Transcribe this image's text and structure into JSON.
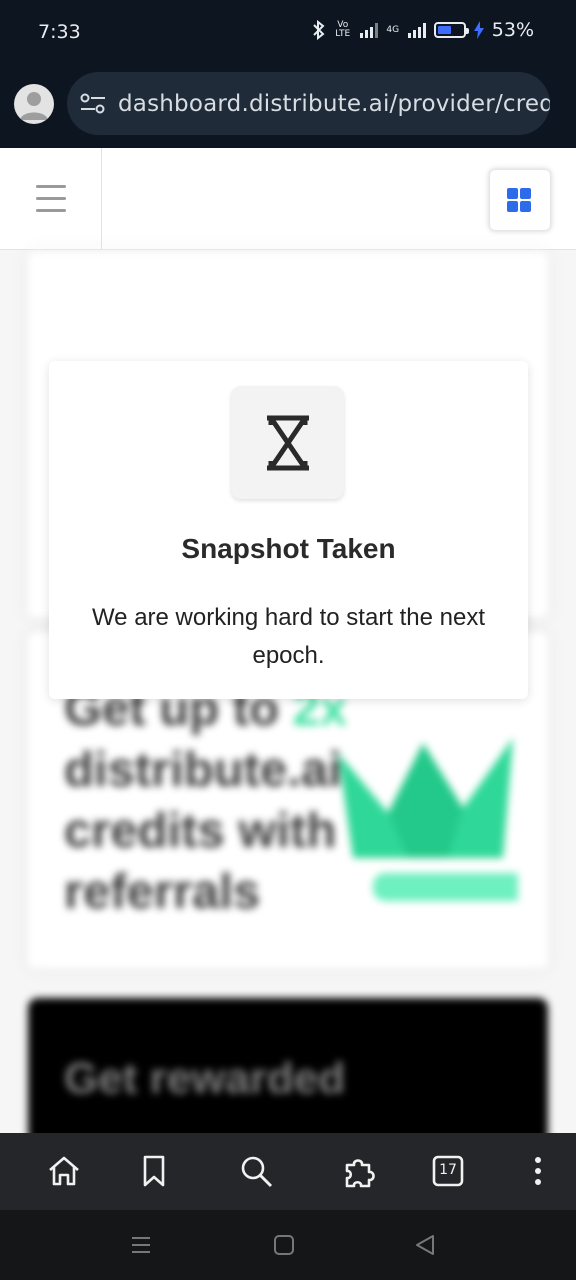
{
  "status_bar": {
    "time": "7:33",
    "volte_label": "Vo LTE",
    "network_label": "4G",
    "battery_percent": "53%",
    "battery_level": 0.53,
    "charging": true
  },
  "browser": {
    "url": "dashboard.distribute.ai/provider/credits",
    "profile_icon": "person-icon",
    "site_settings_icon": "tune-icon"
  },
  "page": {
    "promo": {
      "line_prefix": "Get up to ",
      "accent": "2x",
      "rest": "distribute.ai credits with referrals"
    },
    "dark_card_title": "Get rewarded",
    "accent_color": "#3fe0a3",
    "brand_color": "#2c6bea"
  },
  "modal": {
    "icon": "hourglass-icon",
    "title": "Snapshot Taken",
    "message": "We are working hard to start the next epoch."
  },
  "toolbar": {
    "tab_count": "17",
    "items": [
      "home-icon",
      "bookmark-icon",
      "search-icon",
      "extensions-icon",
      "tabs-icon",
      "more-icon"
    ]
  },
  "system_nav": [
    "recent-apps-icon",
    "home-square-icon",
    "back-icon"
  ]
}
